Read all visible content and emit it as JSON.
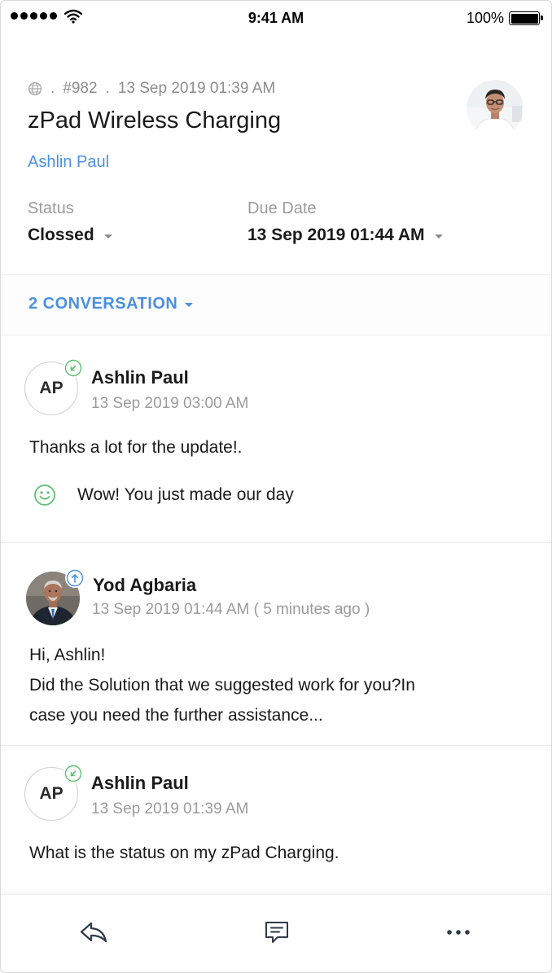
{
  "status_bar": {
    "time": "9:41 AM",
    "battery_percent": "100%"
  },
  "ticket": {
    "number": "#982",
    "created": "13 Sep 2019 01:39 AM",
    "separator": ".",
    "title": "zPad Wireless Charging",
    "contact": "Ashlin Paul",
    "status_label": "Status",
    "status_value": "Clossed",
    "due_label": "Due Date",
    "due_value": "13 Sep 2019 01:44 AM"
  },
  "conversation_toggle": {
    "label": "2 CONVERSATION"
  },
  "threads": [
    {
      "initials": "AP",
      "author": "Ashlin Paul",
      "time": "13 Sep 2019 03:00 AM",
      "body": [
        "Thanks a lot for the update!."
      ],
      "feedback": "Wow! You just made our day",
      "badge": "incoming-arrow-icon"
    },
    {
      "initials": "",
      "author": "Yod Agbaria",
      "time": "13 Sep 2019 01:44 AM ( 5 minutes ago )",
      "body": [
        "Hi, Ashlin!",
        "Did the Solution that we suggested work for you?In",
        "case you need the further assistance..."
      ],
      "badge": "outgoing-arrow-icon"
    },
    {
      "initials": "AP",
      "author": "Ashlin Paul",
      "time": "13 Sep 2019 01:39 AM",
      "body": [
        "What is the status on my zPad Charging."
      ],
      "badge": "incoming-arrow-icon"
    }
  ],
  "toolbar": {
    "icons": [
      "reply-icon",
      "comment-icon",
      "more-icon"
    ]
  },
  "colors": {
    "accent": "#4a90e2",
    "incoming_badge": "#5cc16f",
    "outgoing_badge": "#4a90e2",
    "muted_text": "#9b9b9b"
  }
}
